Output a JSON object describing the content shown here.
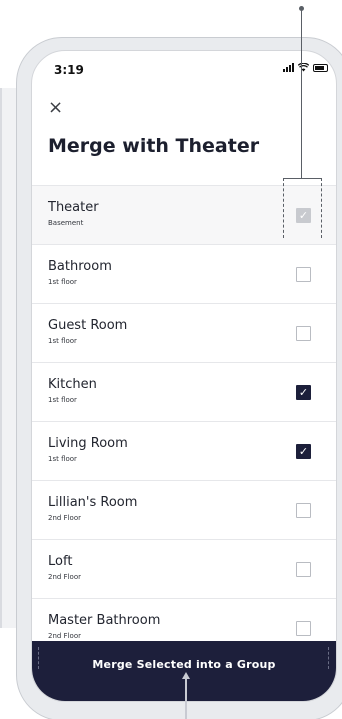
{
  "status": {
    "time": "3:19"
  },
  "header": {
    "close_glyph": "×",
    "title": "Merge with Theater"
  },
  "rooms": [
    {
      "name": "Theater",
      "floor": "Basement",
      "state": "disabled"
    },
    {
      "name": "Bathroom",
      "floor": "1st floor",
      "state": "unchecked"
    },
    {
      "name": "Guest Room",
      "floor": "1st floor",
      "state": "unchecked"
    },
    {
      "name": "Kitchen",
      "floor": "1st floor",
      "state": "checked"
    },
    {
      "name": "Living Room",
      "floor": "1st floor",
      "state": "checked"
    },
    {
      "name": "Lillian's Room",
      "floor": "2nd Floor",
      "state": "unchecked"
    },
    {
      "name": "Loft",
      "floor": "2nd Floor",
      "state": "unchecked"
    },
    {
      "name": "Master Bathroom",
      "floor": "2nd Floor",
      "state": "unchecked"
    }
  ],
  "footer": {
    "button_label": "Merge Selected into a Group"
  },
  "colors": {
    "accent": "#1d1f3b",
    "checked": "#1c1f3a",
    "disabled": "#c8cacf"
  },
  "icons": {
    "close": "close-icon",
    "check": "checkmark-icon"
  }
}
